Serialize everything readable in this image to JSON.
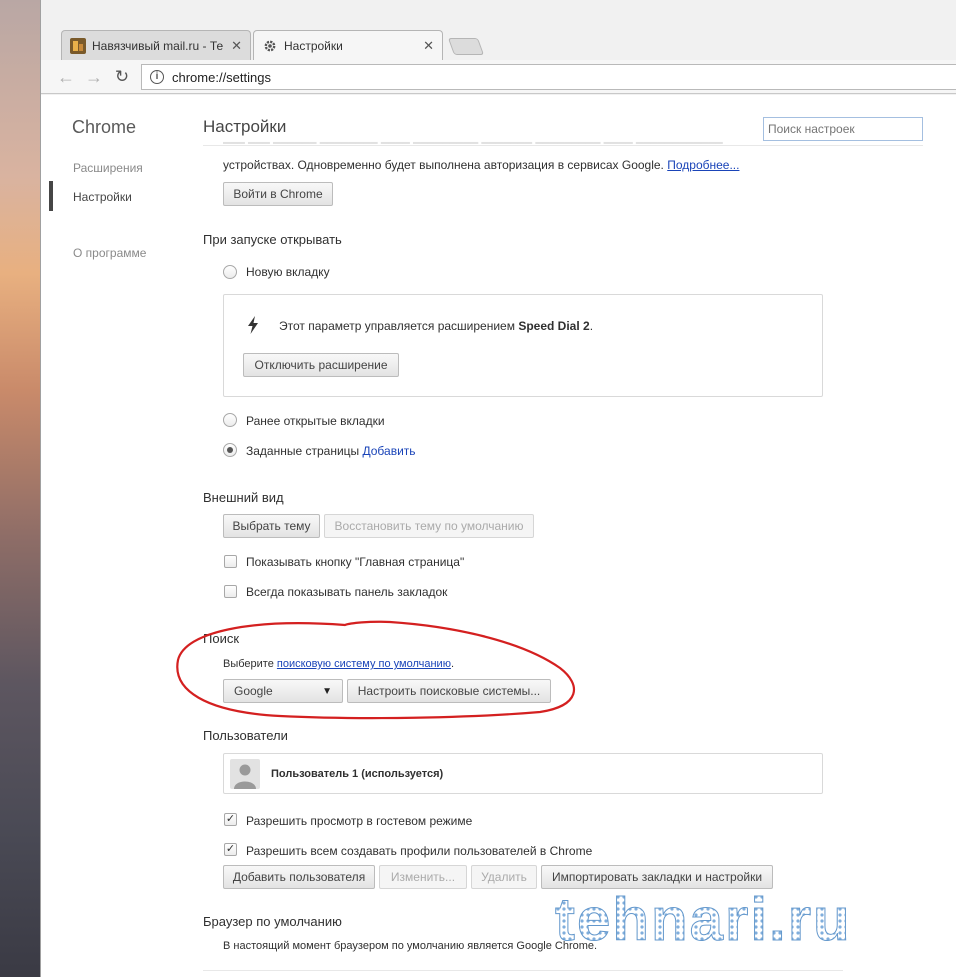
{
  "tabs": [
    {
      "title": "Навязчивый mail.ru - Те",
      "active": false,
      "icon": "site-favicon"
    },
    {
      "title": "Настройки",
      "active": true,
      "icon": "gear-icon"
    }
  ],
  "toolbar": {
    "url": "chrome://settings",
    "back_icon": "←",
    "forward_icon": "→",
    "reload_icon": "↻"
  },
  "sidebar": {
    "brand": "Chrome",
    "items": [
      {
        "label": "Расширения"
      },
      {
        "label": "Настройки",
        "selected": true
      },
      {
        "label": "О программе"
      }
    ]
  },
  "header": {
    "title": "Настройки",
    "search_placeholder": "Поиск настроек"
  },
  "signin": {
    "text": "устройствах. Одновременно будет выполнена авторизация в сервисах Google.",
    "more_link": "Подробнее...",
    "button": "Войти в Chrome"
  },
  "startup": {
    "title": "При запуске открывать",
    "opt_newtab": "Новую вкладку",
    "ext_notice_prefix": "Этот параметр управляется расширением",
    "ext_name": "Speed Dial 2",
    "ext_notice_suffix": ".",
    "disable_ext_button": "Отключить расширение",
    "opt_previous": "Ранее открытые вкладки",
    "opt_pages": "Заданные страницы",
    "add_link": "Добавить"
  },
  "appearance": {
    "title": "Внешний вид",
    "choose_theme": "Выбрать тему",
    "reset_theme": "Восстановить тему по умолчанию",
    "show_home": "Показывать кнопку \"Главная страница\"",
    "show_bookmarks": "Всегда показывать панель закладок"
  },
  "search": {
    "title": "Поиск",
    "prefix": "Выберите",
    "link": "поисковую систему по умолчанию",
    "suffix": ".",
    "engine": "Google",
    "manage_button": "Настроить поисковые системы..."
  },
  "users": {
    "title": "Пользователи",
    "current_user": "Пользователь 1 (используется)",
    "guest_mode": "Разрешить просмотр в гостевом режиме",
    "allow_profiles": "Разрешить всем создавать профили пользователей в Chrome",
    "add_user": "Добавить пользователя",
    "edit": "Изменить...",
    "delete": "Удалить",
    "import": "Импортировать закладки и настройки"
  },
  "default_browser": {
    "title": "Браузер по умолчанию",
    "text": "В настоящий момент браузером по умолчанию является Google Chrome."
  },
  "watermark": {
    "text": "tehnari.ru"
  },
  "colors": {
    "link": "#1a44b8",
    "annotation": "#d42020",
    "watermark": "#4a87c4"
  }
}
